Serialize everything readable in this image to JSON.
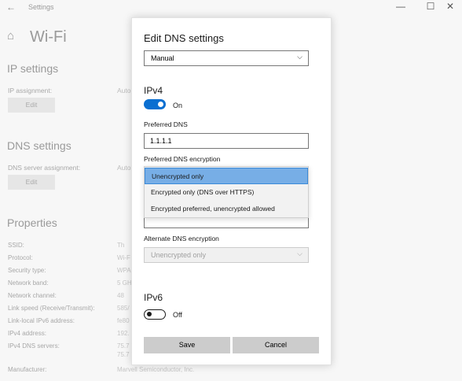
{
  "window": {
    "app_title": "Settings",
    "back_glyph": "←",
    "minimize_glyph": "—",
    "maximize_glyph": "☐",
    "close_glyph": "✕"
  },
  "settings": {
    "home_glyph": "⌂",
    "page_title": "Wi-Fi",
    "ip_settings_title": "IP settings",
    "ip_assignment_label": "IP assignment:",
    "ip_assignment_value": "Auto",
    "edit_label": "Edit",
    "dns_settings_title": "DNS settings",
    "dns_assignment_label": "DNS server assignment:",
    "dns_assignment_value": "Auto",
    "properties_title": "Properties",
    "properties": [
      {
        "label": "SSID:",
        "value": "Th"
      },
      {
        "label": "Protocol:",
        "value": "Wi-F"
      },
      {
        "label": "Security type:",
        "value": "WPA"
      },
      {
        "label": "Network band:",
        "value": "5 GH"
      },
      {
        "label": "Network channel:",
        "value": "48"
      },
      {
        "label": "Link speed (Receive/Transmit):",
        "value": "585/"
      },
      {
        "label": "Link-local IPv6 address:",
        "value": "fe80"
      },
      {
        "label": "IPv4 address:",
        "value": "192."
      },
      {
        "label": "IPv4 DNS servers:",
        "value": "75.7"
      }
    ],
    "ipv4_dns_extra": "75.7",
    "manufacturer_label": "Manufacturer:",
    "manufacturer_value": "Marvell Semiconductor, Inc."
  },
  "dialog": {
    "title": "Edit DNS settings",
    "mode_select": {
      "value": "Manual",
      "chevron": "⌵"
    },
    "ipv4": {
      "heading": "IPv4",
      "toggle_state": "On",
      "toggle_on": true,
      "preferred_dns_label": "Preferred DNS",
      "preferred_dns_value": "1.1.1.1",
      "preferred_encryption_label": "Preferred DNS encryption",
      "encryption_options": [
        "Unencrypted only",
        "Encrypted only (DNS over HTTPS)",
        "Encrypted preferred, unencrypted allowed"
      ],
      "selected_option_index": 0,
      "alternate_encryption_label": "Alternate DNS encryption",
      "alternate_encryption_value": "Unencrypted only"
    },
    "ipv6": {
      "heading": "IPv6",
      "toggle_state": "Off",
      "toggle_on": false
    },
    "save_label": "Save",
    "cancel_label": "Cancel"
  }
}
